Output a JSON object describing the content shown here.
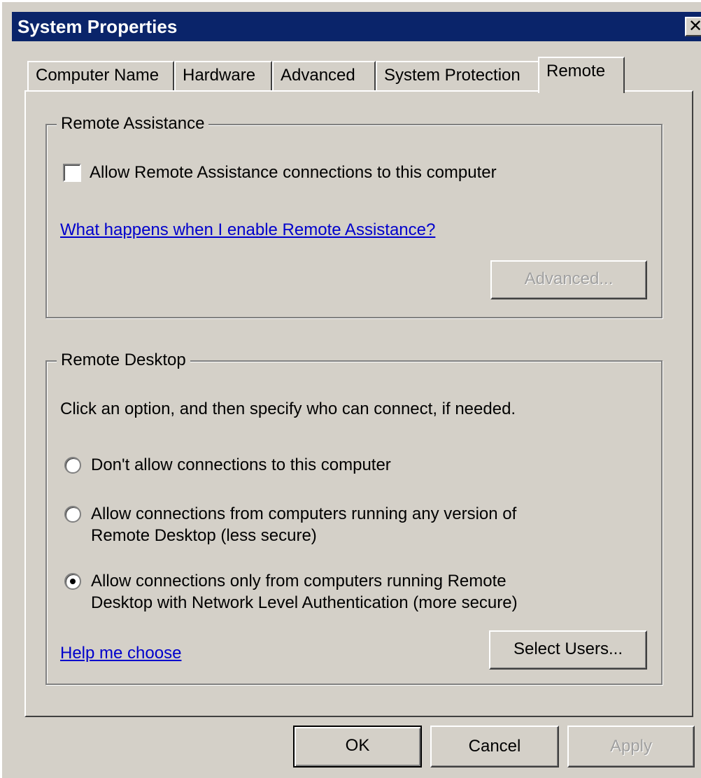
{
  "window": {
    "title": "System Properties",
    "close_glyph": "✕"
  },
  "tabs": [
    {
      "label": "Computer Name",
      "active": false
    },
    {
      "label": "Hardware",
      "active": false
    },
    {
      "label": "Advanced",
      "active": false
    },
    {
      "label": "System Protection",
      "active": false
    },
    {
      "label": "Remote",
      "active": true
    }
  ],
  "remote_assistance": {
    "group_title": "Remote Assistance",
    "allow_checkbox_label": "Allow Remote Assistance connections to this computer",
    "allow_checked": false,
    "help_link": "What happens when I enable Remote Assistance?",
    "advanced_button": "Advanced..."
  },
  "remote_desktop": {
    "group_title": "Remote Desktop",
    "instructions": "Click an option, and then specify who can connect, if needed.",
    "options": [
      {
        "line1": "Don't allow connections to this computer",
        "line2": "",
        "checked": false
      },
      {
        "line1": "Allow connections from computers running any version of",
        "line2": "Remote Desktop (less secure)",
        "checked": false
      },
      {
        "line1": "Allow connections only from computers running Remote",
        "line2": "Desktop with Network Level Authentication (more secure)",
        "checked": true
      }
    ],
    "help_link": "Help me choose",
    "select_users_button": "Select Users..."
  },
  "footer": {
    "ok": "OK",
    "cancel": "Cancel",
    "apply": "Apply"
  },
  "colors": {
    "titlebar": "#0a246a",
    "face": "#d4d0c8",
    "link": "#0000cc"
  }
}
